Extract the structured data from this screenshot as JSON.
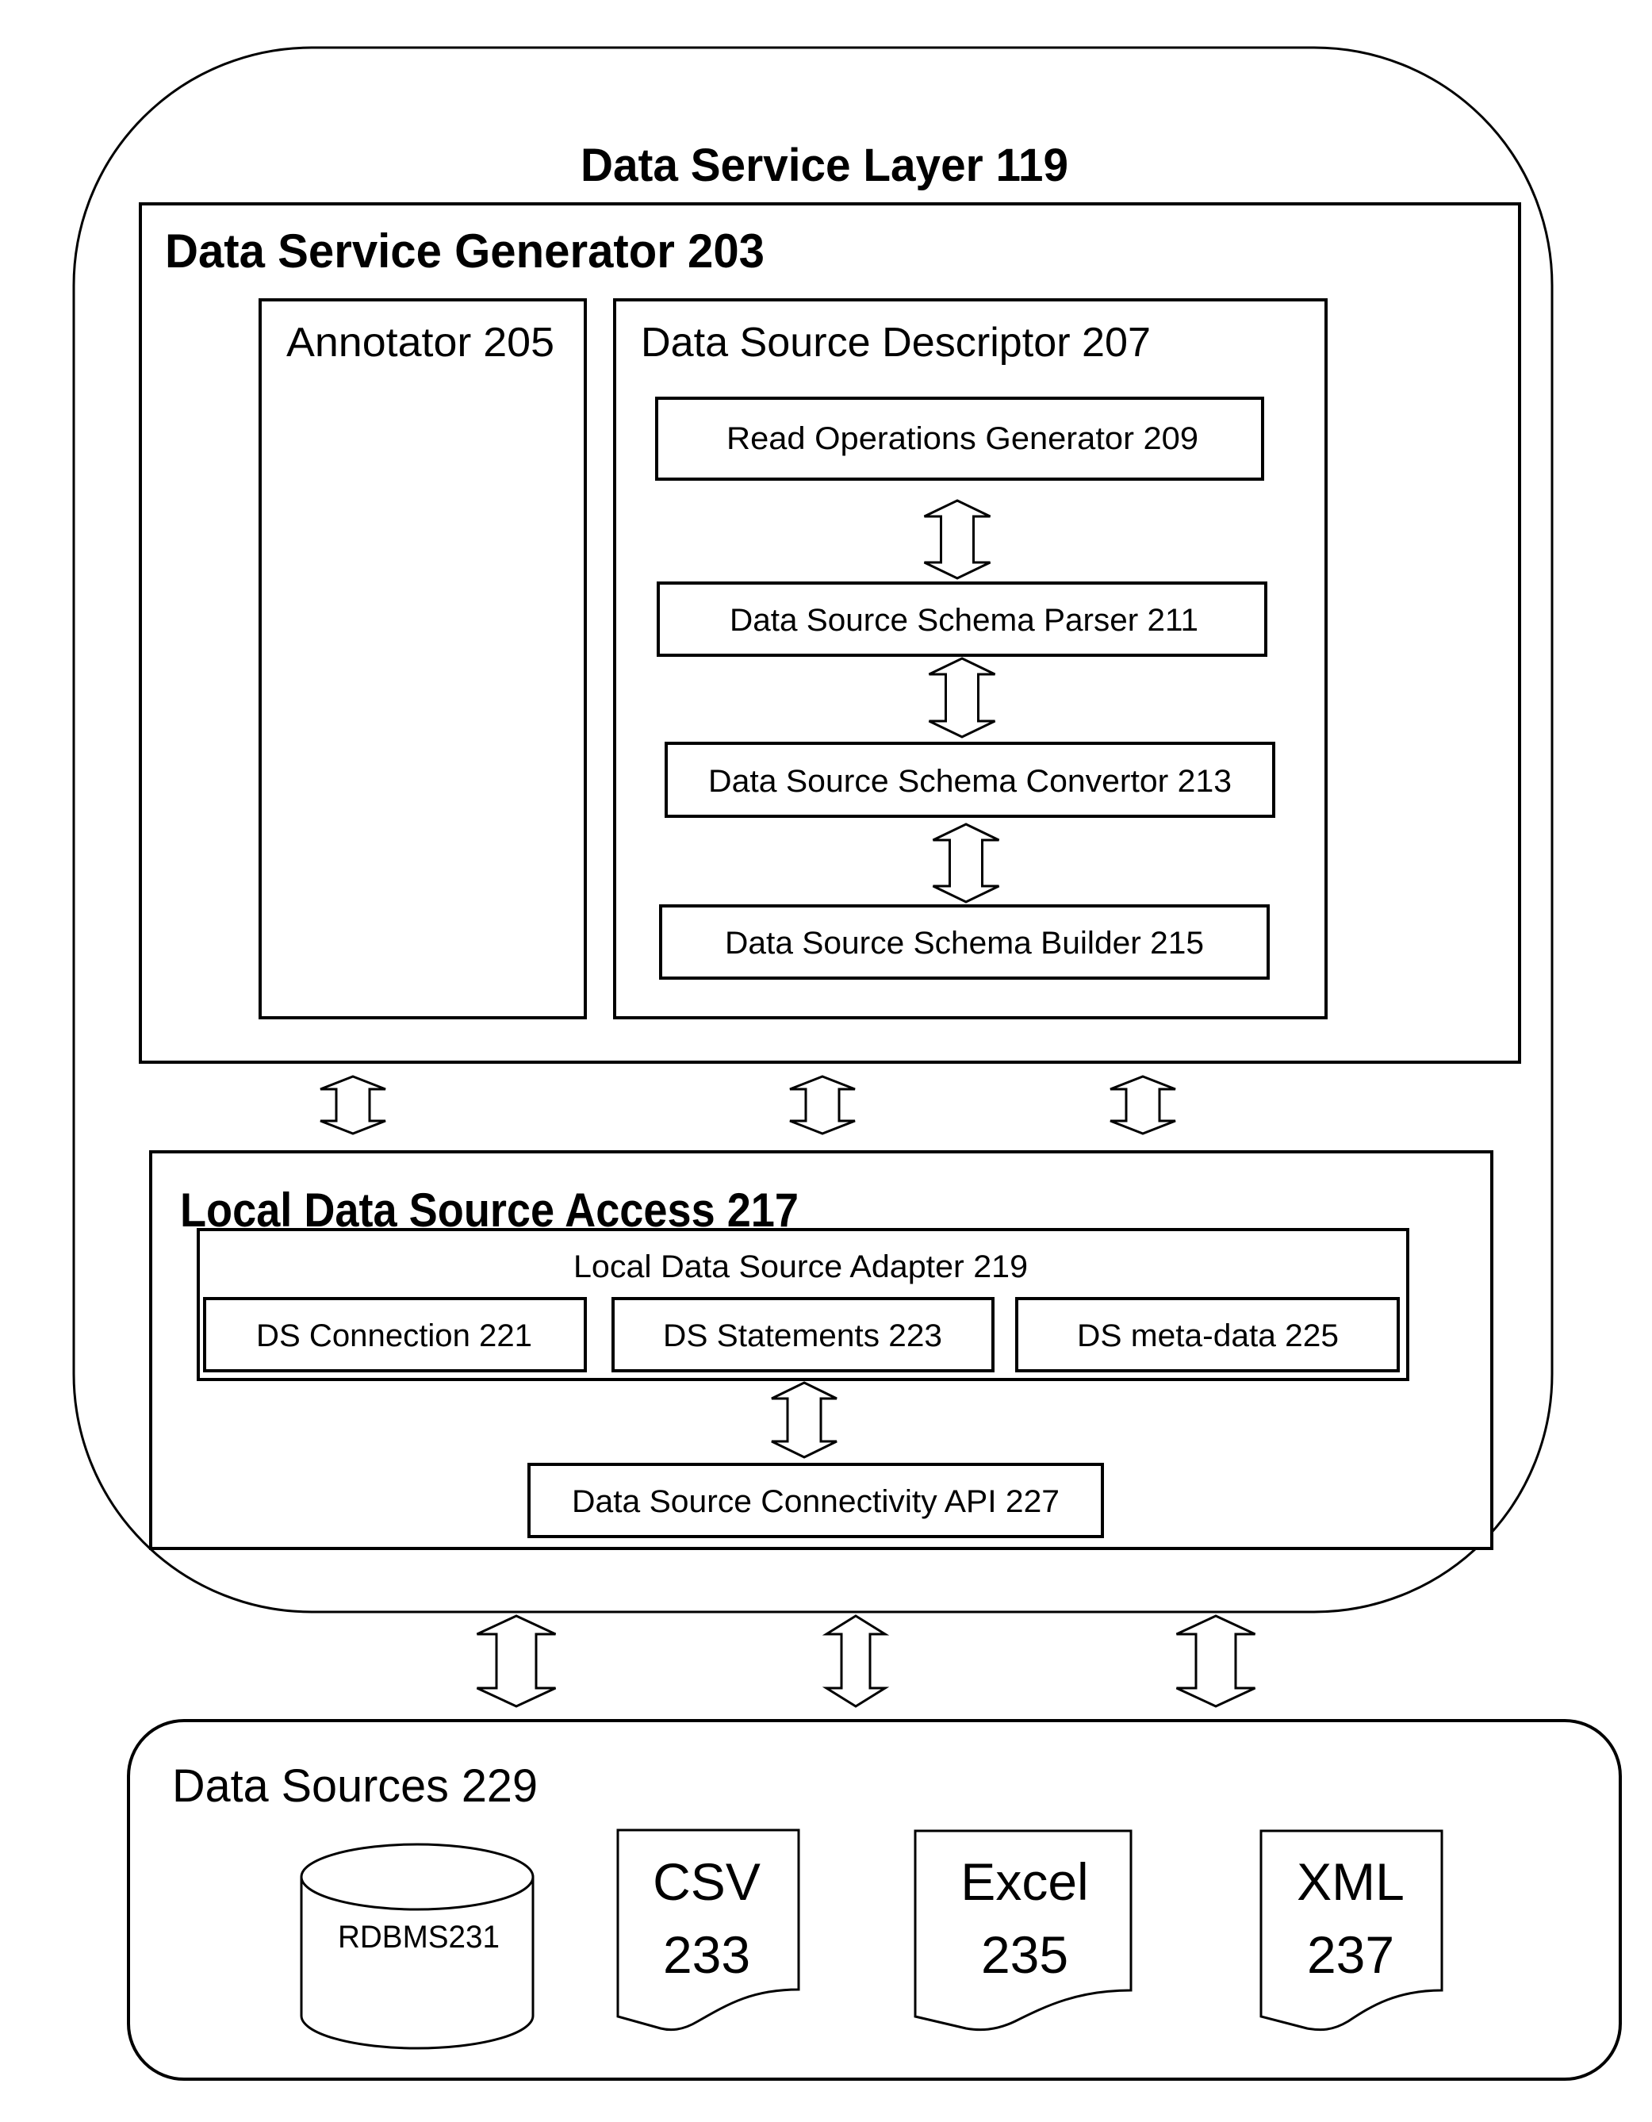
{
  "diagram": {
    "type": "block-diagram",
    "colors": {
      "line": "#000000",
      "fill": "#ffffff",
      "text": "#000000"
    }
  },
  "data_service_layer": {
    "title": "Data Service Layer 119",
    "data_service_generator": {
      "title": "Data Service Generator 203",
      "annotator": {
        "title": "Annotator 205"
      },
      "data_source_descriptor": {
        "title": "Data Source Descriptor 207",
        "components": [
          {
            "label": "Read Operations Generator 209"
          },
          {
            "label": "Data Source Schema Parser 211"
          },
          {
            "label": "Data Source Schema Convertor 213"
          },
          {
            "label": "Data Source Schema Builder 215"
          }
        ]
      }
    },
    "local_data_source_access": {
      "title": "Local Data Source Access 217",
      "adapter": {
        "title": "Local Data Source Adapter 219",
        "components": [
          {
            "label": "DS Connection 221"
          },
          {
            "label": "DS Statements 223"
          },
          {
            "label": "DS meta-data 225"
          }
        ]
      },
      "connectivity_api": {
        "label": "Data Source Connectivity API 227"
      }
    }
  },
  "data_sources": {
    "title": "Data Sources 229",
    "items": [
      {
        "kind": "database",
        "icon": "database-cylinder-icon",
        "lines": [
          "RDBMS231"
        ]
      },
      {
        "kind": "document",
        "icon": "document-icon",
        "lines": [
          "CSV",
          "233"
        ]
      },
      {
        "kind": "document",
        "icon": "document-icon",
        "lines": [
          "Excel",
          "235"
        ]
      },
      {
        "kind": "document",
        "icon": "document-icon",
        "lines": [
          "XML",
          "237"
        ]
      }
    ]
  },
  "connections": {
    "descriptor_chain": [
      "bidirectional",
      "bidirectional",
      "bidirectional"
    ],
    "generator_to_local_access": [
      "bidirectional",
      "bidirectional",
      "bidirectional"
    ],
    "adapter_to_api": [
      "bidirectional"
    ],
    "layer_to_data_sources": [
      "bidirectional",
      "bidirectional",
      "bidirectional"
    ]
  }
}
